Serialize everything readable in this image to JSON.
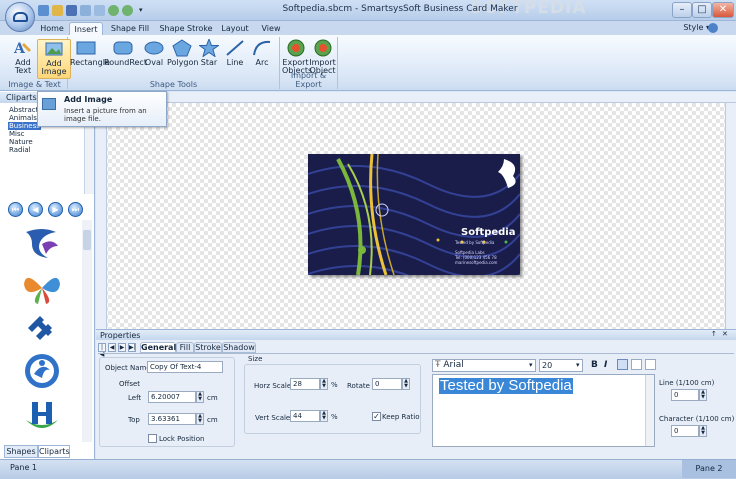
{
  "window": {
    "title": "Softpedia.sbcm - SmartsysSoft Business Card Maker",
    "watermark": "SOFTPEDIA",
    "controls": [
      "–",
      "□",
      "✕"
    ]
  },
  "tabs": [
    "Home",
    "Insert",
    "Shape Fill",
    "Shape Stroke",
    "Layout",
    "View"
  ],
  "active_tab": "Insert",
  "style_menu": "Style",
  "ribbon": {
    "groups": [
      {
        "label": "Image & Text",
        "buttons": [
          {
            "line1": "Add",
            "line2": "Text"
          },
          {
            "line1": "Add",
            "line2": "Image"
          }
        ]
      },
      {
        "label": "Shape Tools",
        "buttons": [
          {
            "line1": "Rectangle",
            "line2": ""
          },
          {
            "line1": "RoundRect",
            "line2": ""
          },
          {
            "line1": "Oval",
            "line2": ""
          },
          {
            "line1": "Polygon",
            "line2": ""
          },
          {
            "line1": "Star",
            "line2": ""
          },
          {
            "line1": "Line",
            "line2": ""
          },
          {
            "line1": "Arc",
            "line2": ""
          }
        ]
      },
      {
        "label": "Import & Export",
        "buttons": [
          {
            "line1": "Export",
            "line2": "Objects"
          },
          {
            "line1": "Import",
            "line2": "Object"
          }
        ]
      }
    ]
  },
  "tooltip": {
    "title": "Add Image",
    "description": "Insert a picture from an image file."
  },
  "left_panel": {
    "header": "Cliparts",
    "categories": [
      "Abstract",
      "Animals",
      "Business",
      "Misc",
      "Nature",
      "Radial"
    ],
    "selected_category": "Business",
    "nav": [
      "⏮",
      "◀",
      "▶",
      "⏭"
    ],
    "tabs": [
      "Shapes",
      "Cliparts"
    ],
    "active_tab": "Cliparts"
  },
  "card": {
    "title": "Softpedia",
    "lines": [
      "Tested by Softpedia",
      "Softpedia Labs",
      "Tel: (000)123 456 78",
      "marinesoftpedia.com"
    ]
  },
  "properties": {
    "header": "Properties",
    "header_icons": [
      "↑",
      "✕"
    ],
    "tabs": [
      "General",
      "Fill",
      "Stroke",
      "Shadow"
    ],
    "active_tab": "General",
    "object_name_label": "Object Name",
    "object_name": "Copy Of Text-4",
    "offset_label": "Offset",
    "left_label": "Left",
    "left_value": "6.20007",
    "top_label": "Top",
    "top_value": "3.63361",
    "unit": "cm",
    "lock_position_label": "Lock Position",
    "size_label": "Size",
    "horz_scale_label": "Horz Scale",
    "horz_scale": "28",
    "vert_scale_label": "Vert Scale",
    "vert_scale": "44",
    "percent": "%",
    "rotate_label": "Rotate",
    "rotate": "0",
    "keep_ratio_label": "Keep Ratio",
    "keep_ratio": true,
    "font": "Arial",
    "font_size": "20",
    "format_buttons": [
      "B",
      "I"
    ],
    "text": "Tested by Softpedia",
    "line_label": "Line (1/100 cm)",
    "line_value": "0",
    "character_label": "Character (1/100 cm)",
    "character_value": "0"
  },
  "status": {
    "pane1": "Pane 1",
    "pane2": "Pane 2"
  }
}
